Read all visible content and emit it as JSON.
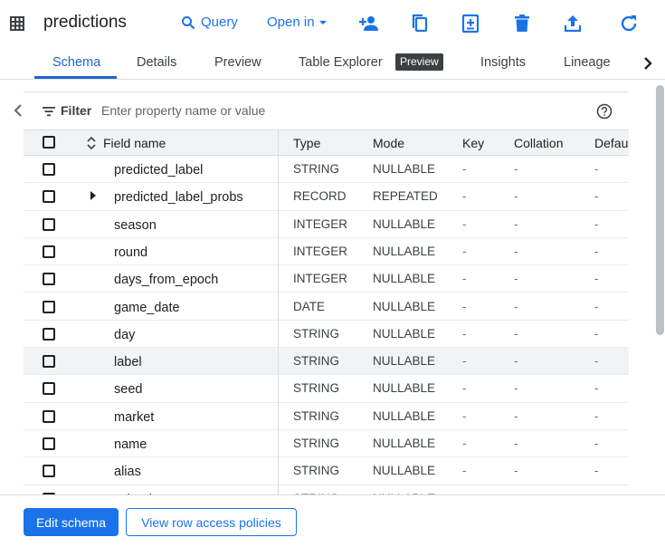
{
  "header": {
    "title": "predictions",
    "query_label": "Query",
    "open_in_label": "Open in",
    "icons": [
      "table-icon",
      "search-icon",
      "chevron-down-icon",
      "share-person-add-icon",
      "copy-icon",
      "snapshot-add-icon",
      "delete-icon",
      "upload-export-icon",
      "refresh-icon"
    ],
    "accent_color": "#1a73e8"
  },
  "tabs": {
    "items": [
      {
        "label": "Schema",
        "active": true
      },
      {
        "label": "Details",
        "active": false
      },
      {
        "label": "Preview",
        "active": false
      },
      {
        "label": "Table Explorer",
        "active": false
      },
      {
        "label": "Insights",
        "active": false
      },
      {
        "label": "Lineage",
        "active": false
      }
    ],
    "badge": "Preview"
  },
  "filter": {
    "label": "Filter",
    "placeholder": "Enter property name or value"
  },
  "table": {
    "columns": [
      "Field name",
      "Type",
      "Mode",
      "Key",
      "Collation",
      "Defau"
    ],
    "rows": [
      {
        "name": "predicted_label",
        "type": "STRING",
        "mode": "NULLABLE",
        "key": "-",
        "collation": "-",
        "default": "-"
      },
      {
        "name": "predicted_label_probs",
        "type": "RECORD",
        "mode": "REPEATED",
        "key": "-",
        "collation": "-",
        "default": "-"
      },
      {
        "name": "season",
        "type": "INTEGER",
        "mode": "NULLABLE",
        "key": "-",
        "collation": "-",
        "default": "-"
      },
      {
        "name": "round",
        "type": "INTEGER",
        "mode": "NULLABLE",
        "key": "-",
        "collation": "-",
        "default": "-"
      },
      {
        "name": "days_from_epoch",
        "type": "INTEGER",
        "mode": "NULLABLE",
        "key": "-",
        "collation": "-",
        "default": "-"
      },
      {
        "name": "game_date",
        "type": "DATE",
        "mode": "NULLABLE",
        "key": "-",
        "collation": "-",
        "default": "-"
      },
      {
        "name": "day",
        "type": "STRING",
        "mode": "NULLABLE",
        "key": "-",
        "collation": "-",
        "default": "-"
      },
      {
        "name": "label",
        "type": "STRING",
        "mode": "NULLABLE",
        "key": "-",
        "collation": "-",
        "default": "-"
      },
      {
        "name": "seed",
        "type": "STRING",
        "mode": "NULLABLE",
        "key": "-",
        "collation": "-",
        "default": "-"
      },
      {
        "name": "market",
        "type": "STRING",
        "mode": "NULLABLE",
        "key": "-",
        "collation": "-",
        "default": "-"
      },
      {
        "name": "name",
        "type": "STRING",
        "mode": "NULLABLE",
        "key": "-",
        "collation": "-",
        "default": "-"
      },
      {
        "name": "alias",
        "type": "STRING",
        "mode": "NULLABLE",
        "key": "-",
        "collation": "-",
        "default": "-"
      },
      {
        "name": "school_ncaa",
        "type": "STRING",
        "mode": "NULLABLE",
        "key": "-",
        "collation": "-",
        "default": "-"
      }
    ]
  },
  "footer": {
    "edit_schema_label": "Edit schema",
    "row_access_label": "View row access policies"
  }
}
